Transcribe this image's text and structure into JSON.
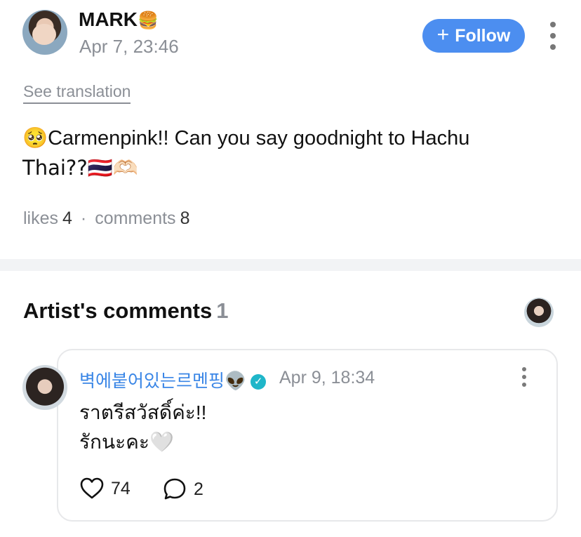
{
  "post": {
    "author": {
      "name": "MARK",
      "name_emoji": "🍔"
    },
    "date": "Apr 7, 23:46",
    "follow_label": "Follow",
    "see_translation": "See translation",
    "body_line1": "🥺Carmenpink!! Can you say goodnight to Hachu",
    "body_line2": "Thai??🇹🇭🫶🏻",
    "stats": {
      "likes_label": "likes",
      "likes_count": "4",
      "separator": "·",
      "comments_label": "comments",
      "comments_count": "8"
    }
  },
  "artist_comments": {
    "title": "Artist's comments",
    "count": "1",
    "items": [
      {
        "author": "벽에붙어있는르멘핑",
        "author_emoji": "👽",
        "verified": true,
        "date": "Apr 9, 18:34",
        "text": "ราตรีสวัสดิ์ค่ะ!!\nรักนะคะ🤍",
        "likes": "74",
        "replies": "2"
      }
    ]
  },
  "icons": {
    "plus": "plus-icon",
    "more": "more-vertical-icon",
    "verified": "verified-badge-icon",
    "heart": "heart-outline-icon",
    "reply": "speech-bubble-icon"
  },
  "colors": {
    "accent": "#4c8ef0",
    "artist_name": "#3a86e6",
    "verified": "#1fb6c9",
    "muted": "#8b8f96",
    "divider": "#f2f3f5"
  }
}
